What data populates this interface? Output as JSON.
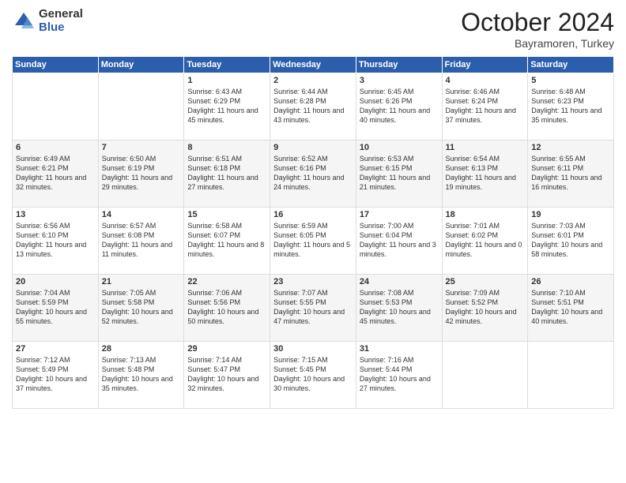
{
  "logo": {
    "general": "General",
    "blue": "Blue"
  },
  "header": {
    "month": "October 2024",
    "location": "Bayramoren, Turkey"
  },
  "days_of_week": [
    "Sunday",
    "Monday",
    "Tuesday",
    "Wednesday",
    "Thursday",
    "Friday",
    "Saturday"
  ],
  "weeks": [
    [
      {
        "day": "",
        "sunrise": "",
        "sunset": "",
        "daylight": ""
      },
      {
        "day": "",
        "sunrise": "",
        "sunset": "",
        "daylight": ""
      },
      {
        "day": "1",
        "sunrise": "Sunrise: 6:43 AM",
        "sunset": "Sunset: 6:29 PM",
        "daylight": "Daylight: 11 hours and 45 minutes."
      },
      {
        "day": "2",
        "sunrise": "Sunrise: 6:44 AM",
        "sunset": "Sunset: 6:28 PM",
        "daylight": "Daylight: 11 hours and 43 minutes."
      },
      {
        "day": "3",
        "sunrise": "Sunrise: 6:45 AM",
        "sunset": "Sunset: 6:26 PM",
        "daylight": "Daylight: 11 hours and 40 minutes."
      },
      {
        "day": "4",
        "sunrise": "Sunrise: 6:46 AM",
        "sunset": "Sunset: 6:24 PM",
        "daylight": "Daylight: 11 hours and 37 minutes."
      },
      {
        "day": "5",
        "sunrise": "Sunrise: 6:48 AM",
        "sunset": "Sunset: 6:23 PM",
        "daylight": "Daylight: 11 hours and 35 minutes."
      }
    ],
    [
      {
        "day": "6",
        "sunrise": "Sunrise: 6:49 AM",
        "sunset": "Sunset: 6:21 PM",
        "daylight": "Daylight: 11 hours and 32 minutes."
      },
      {
        "day": "7",
        "sunrise": "Sunrise: 6:50 AM",
        "sunset": "Sunset: 6:19 PM",
        "daylight": "Daylight: 11 hours and 29 minutes."
      },
      {
        "day": "8",
        "sunrise": "Sunrise: 6:51 AM",
        "sunset": "Sunset: 6:18 PM",
        "daylight": "Daylight: 11 hours and 27 minutes."
      },
      {
        "day": "9",
        "sunrise": "Sunrise: 6:52 AM",
        "sunset": "Sunset: 6:16 PM",
        "daylight": "Daylight: 11 hours and 24 minutes."
      },
      {
        "day": "10",
        "sunrise": "Sunrise: 6:53 AM",
        "sunset": "Sunset: 6:15 PM",
        "daylight": "Daylight: 11 hours and 21 minutes."
      },
      {
        "day": "11",
        "sunrise": "Sunrise: 6:54 AM",
        "sunset": "Sunset: 6:13 PM",
        "daylight": "Daylight: 11 hours and 19 minutes."
      },
      {
        "day": "12",
        "sunrise": "Sunrise: 6:55 AM",
        "sunset": "Sunset: 6:11 PM",
        "daylight": "Daylight: 11 hours and 16 minutes."
      }
    ],
    [
      {
        "day": "13",
        "sunrise": "Sunrise: 6:56 AM",
        "sunset": "Sunset: 6:10 PM",
        "daylight": "Daylight: 11 hours and 13 minutes."
      },
      {
        "day": "14",
        "sunrise": "Sunrise: 6:57 AM",
        "sunset": "Sunset: 6:08 PM",
        "daylight": "Daylight: 11 hours and 11 minutes."
      },
      {
        "day": "15",
        "sunrise": "Sunrise: 6:58 AM",
        "sunset": "Sunset: 6:07 PM",
        "daylight": "Daylight: 11 hours and 8 minutes."
      },
      {
        "day": "16",
        "sunrise": "Sunrise: 6:59 AM",
        "sunset": "Sunset: 6:05 PM",
        "daylight": "Daylight: 11 hours and 5 minutes."
      },
      {
        "day": "17",
        "sunrise": "Sunrise: 7:00 AM",
        "sunset": "Sunset: 6:04 PM",
        "daylight": "Daylight: 11 hours and 3 minutes."
      },
      {
        "day": "18",
        "sunrise": "Sunrise: 7:01 AM",
        "sunset": "Sunset: 6:02 PM",
        "daylight": "Daylight: 11 hours and 0 minutes."
      },
      {
        "day": "19",
        "sunrise": "Sunrise: 7:03 AM",
        "sunset": "Sunset: 6:01 PM",
        "daylight": "Daylight: 10 hours and 58 minutes."
      }
    ],
    [
      {
        "day": "20",
        "sunrise": "Sunrise: 7:04 AM",
        "sunset": "Sunset: 5:59 PM",
        "daylight": "Daylight: 10 hours and 55 minutes."
      },
      {
        "day": "21",
        "sunrise": "Sunrise: 7:05 AM",
        "sunset": "Sunset: 5:58 PM",
        "daylight": "Daylight: 10 hours and 52 minutes."
      },
      {
        "day": "22",
        "sunrise": "Sunrise: 7:06 AM",
        "sunset": "Sunset: 5:56 PM",
        "daylight": "Daylight: 10 hours and 50 minutes."
      },
      {
        "day": "23",
        "sunrise": "Sunrise: 7:07 AM",
        "sunset": "Sunset: 5:55 PM",
        "daylight": "Daylight: 10 hours and 47 minutes."
      },
      {
        "day": "24",
        "sunrise": "Sunrise: 7:08 AM",
        "sunset": "Sunset: 5:53 PM",
        "daylight": "Daylight: 10 hours and 45 minutes."
      },
      {
        "day": "25",
        "sunrise": "Sunrise: 7:09 AM",
        "sunset": "Sunset: 5:52 PM",
        "daylight": "Daylight: 10 hours and 42 minutes."
      },
      {
        "day": "26",
        "sunrise": "Sunrise: 7:10 AM",
        "sunset": "Sunset: 5:51 PM",
        "daylight": "Daylight: 10 hours and 40 minutes."
      }
    ],
    [
      {
        "day": "27",
        "sunrise": "Sunrise: 7:12 AM",
        "sunset": "Sunset: 5:49 PM",
        "daylight": "Daylight: 10 hours and 37 minutes."
      },
      {
        "day": "28",
        "sunrise": "Sunrise: 7:13 AM",
        "sunset": "Sunset: 5:48 PM",
        "daylight": "Daylight: 10 hours and 35 minutes."
      },
      {
        "day": "29",
        "sunrise": "Sunrise: 7:14 AM",
        "sunset": "Sunset: 5:47 PM",
        "daylight": "Daylight: 10 hours and 32 minutes."
      },
      {
        "day": "30",
        "sunrise": "Sunrise: 7:15 AM",
        "sunset": "Sunset: 5:45 PM",
        "daylight": "Daylight: 10 hours and 30 minutes."
      },
      {
        "day": "31",
        "sunrise": "Sunrise: 7:16 AM",
        "sunset": "Sunset: 5:44 PM",
        "daylight": "Daylight: 10 hours and 27 minutes."
      },
      {
        "day": "",
        "sunrise": "",
        "sunset": "",
        "daylight": ""
      },
      {
        "day": "",
        "sunrise": "",
        "sunset": "",
        "daylight": ""
      }
    ]
  ]
}
